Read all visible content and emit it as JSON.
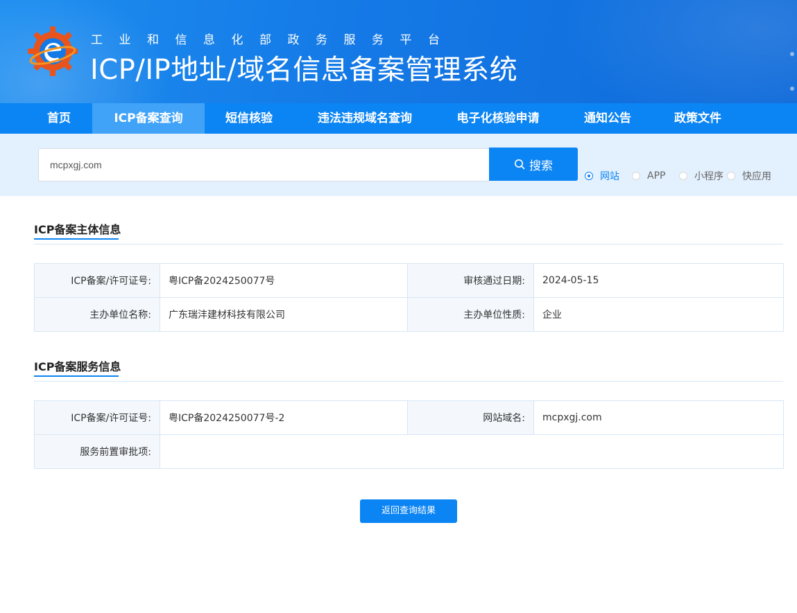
{
  "header": {
    "subtitle": "工业和信息化部政务服务平台",
    "title": "ICP/IP地址/域名信息备案管理系统"
  },
  "nav": {
    "items": [
      {
        "label": "首页"
      },
      {
        "label": "ICP备案查询"
      },
      {
        "label": "短信核验"
      },
      {
        "label": "违法违规域名查询"
      },
      {
        "label": "电子化核验申请"
      },
      {
        "label": "通知公告"
      },
      {
        "label": "政策文件"
      }
    ],
    "active": "ICP备案查询"
  },
  "search": {
    "value": "mcpxgj.com",
    "button_label": "搜索",
    "options": [
      {
        "label": "网站",
        "checked": true
      },
      {
        "label": "APP",
        "checked": false
      },
      {
        "label": "小程序",
        "checked": false
      },
      {
        "label": "快应用",
        "checked": false
      }
    ]
  },
  "subject_info": {
    "title": "ICP备案主体信息",
    "rows": [
      {
        "k1": "ICP备案/许可证号:",
        "v1": "粤ICP备2024250077号",
        "k2": "审核通过日期:",
        "v2": "2024-05-15"
      },
      {
        "k1": "主办单位名称:",
        "v1": "广东瑞沣建材科技有限公司",
        "k2": "主办单位性质:",
        "v2": "企业"
      }
    ]
  },
  "service_info": {
    "title": "ICP备案服务信息",
    "rows": [
      {
        "k1": "ICP备案/许可证号:",
        "v1": "粤ICP备2024250077号-2",
        "k2": "网站域名:",
        "v2": "mcpxgj.com"
      },
      {
        "k1": "服务前置审批项:",
        "v1": ""
      }
    ]
  },
  "back_button": {
    "label": "返回查询结果"
  },
  "colors": {
    "primary": "#0b84f4",
    "nav_active": "#40a3f8",
    "search_bg": "#e3f0fd",
    "logo_orange": "#e8541c"
  }
}
